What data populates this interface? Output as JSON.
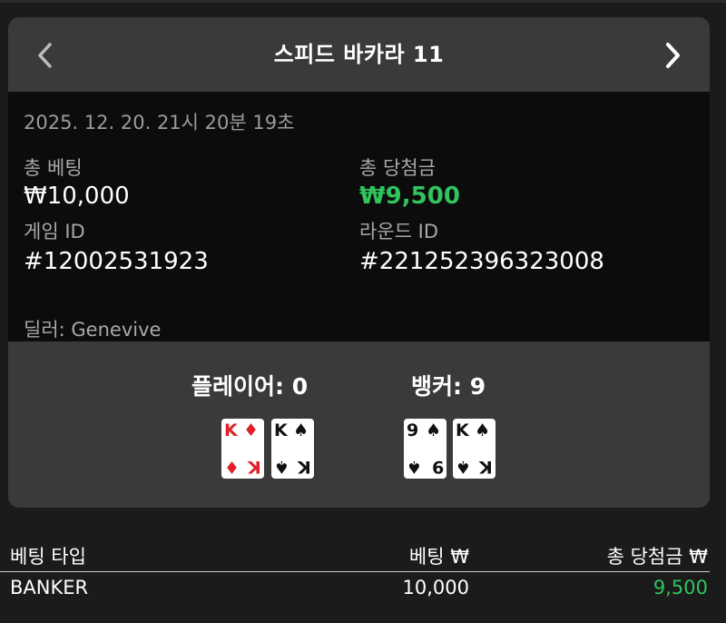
{
  "header": {
    "title": "스피드 바카라 11",
    "prev_icon": "chevron-left-icon",
    "next_icon": "chevron-right-icon"
  },
  "info": {
    "date": "2025. 12. 20. 21시 20분 19초",
    "total_bet_label": "총 베팅",
    "total_bet_value": "₩10,000",
    "total_win_label": "총 당첨금",
    "total_win_value": "₩9,500",
    "game_id_label": "게임 ID",
    "game_id_value": "#12002531923",
    "round_id_label": "라운드 ID",
    "round_id_value": "#221252396323008",
    "dealer": "딜러: Genevive"
  },
  "result": {
    "player_label": "플레이어: 0",
    "banker_label": "뱅커: 9",
    "player_cards": [
      {
        "rank": "K",
        "suit": "♦",
        "color": "red"
      },
      {
        "rank": "K",
        "suit": "♠",
        "color": "black"
      }
    ],
    "banker_cards": [
      {
        "rank": "9",
        "suit": "♠",
        "color": "black"
      },
      {
        "rank": "K",
        "suit": "♠",
        "color": "black"
      }
    ]
  },
  "table": {
    "headers": {
      "bet_type": "베팅 타입",
      "bet": "베팅 ₩",
      "total_win": "총 당첨금 ₩"
    },
    "rows": [
      {
        "bet_type": "BANKER",
        "bet": "10,000",
        "total_win": "9,500"
      }
    ]
  },
  "colors": {
    "win_green": "#2fc45e",
    "panel_bg": "#3a3a3a",
    "info_bg": "#0c0c0c",
    "page_bg": "#1b1b1b"
  }
}
